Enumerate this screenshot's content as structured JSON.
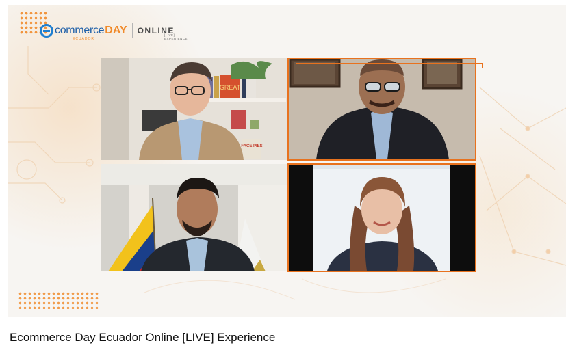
{
  "video": {
    "title": "Ecommerce Day Ecuador Online [LIVE] Experience"
  },
  "branding": {
    "logo_commerce": "commerce",
    "logo_day": "DAY",
    "logo_country": "ECUADOR",
    "logo_online": "ONLINE",
    "logo_sub": "[LIVE] EXPERIENCE"
  },
  "participants": [
    {
      "tile": "top-left",
      "book_text": "GREAT",
      "book2_text": "FACE PIES"
    },
    {
      "tile": "top-right"
    },
    {
      "tile": "bottom-left"
    },
    {
      "tile": "bottom-right"
    }
  ],
  "colors": {
    "accent": "#e8721e",
    "brand_blue": "#1d5fa8",
    "brand_orange": "#f08a2a",
    "background": "#f7f5f2"
  }
}
